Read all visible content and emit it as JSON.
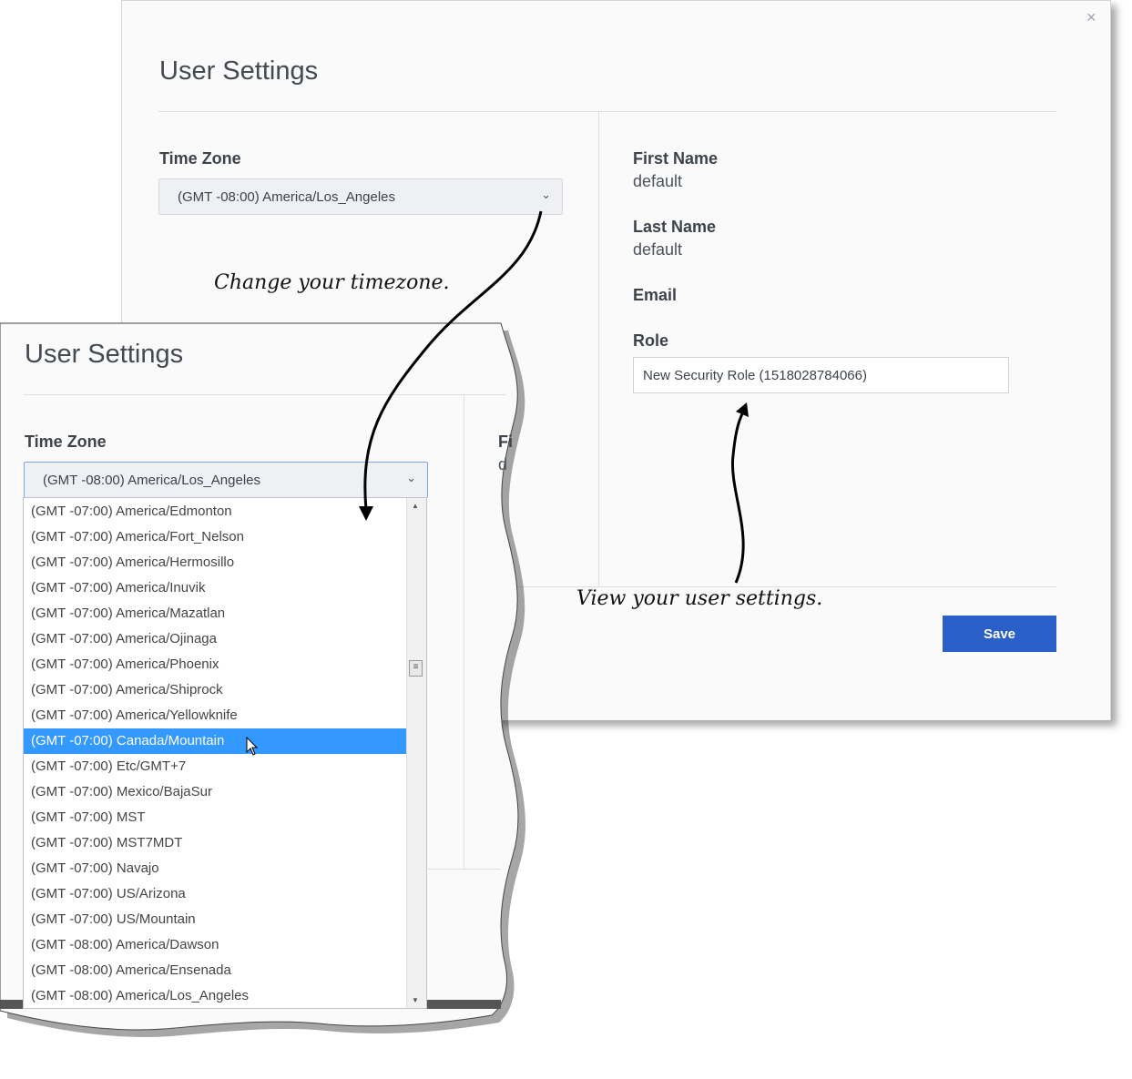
{
  "back_dialog": {
    "title": "User Settings",
    "close_label": "×",
    "time_zone_label": "Time Zone",
    "time_zone_value": "(GMT -08:00) America/Los_Angeles",
    "first_name_label": "First Name",
    "first_name_value": "default",
    "last_name_label": "Last Name",
    "last_name_value": "default",
    "email_label": "Email",
    "role_label": "Role",
    "role_value": "New Security Role (1518028784066)",
    "save_label": "Save"
  },
  "front_dialog": {
    "title": "User Settings",
    "time_zone_label": "Time Zone",
    "time_zone_value": "(GMT -08:00) America/Los_Angeles",
    "first_name_partial": "Fi",
    "first_name_value_partial": "d"
  },
  "dropdown": {
    "items": [
      "(GMT -07:00) America/Edmonton",
      "(GMT -07:00) America/Fort_Nelson",
      "(GMT -07:00) America/Hermosillo",
      "(GMT -07:00) America/Inuvik",
      "(GMT -07:00) America/Mazatlan",
      "(GMT -07:00) America/Ojinaga",
      "(GMT -07:00) America/Phoenix",
      "(GMT -07:00) America/Shiprock",
      "(GMT -07:00) America/Yellowknife",
      "(GMT -07:00) Canada/Mountain",
      "(GMT -07:00) Etc/GMT+7",
      "(GMT -07:00) Mexico/BajaSur",
      "(GMT -07:00) MST",
      "(GMT -07:00) MST7MDT",
      "(GMT -07:00) Navajo",
      "(GMT -07:00) US/Arizona",
      "(GMT -07:00) US/Mountain",
      "(GMT -08:00) America/Dawson",
      "(GMT -08:00) America/Ensenada",
      "(GMT -08:00) America/Los_Angeles"
    ],
    "selected_index": 9
  },
  "annotations": {
    "timezone_note": "Change your timezone.",
    "settings_note": "View your user settings."
  },
  "colors": {
    "accent": "#2a60c8",
    "highlight": "#3399ff"
  }
}
